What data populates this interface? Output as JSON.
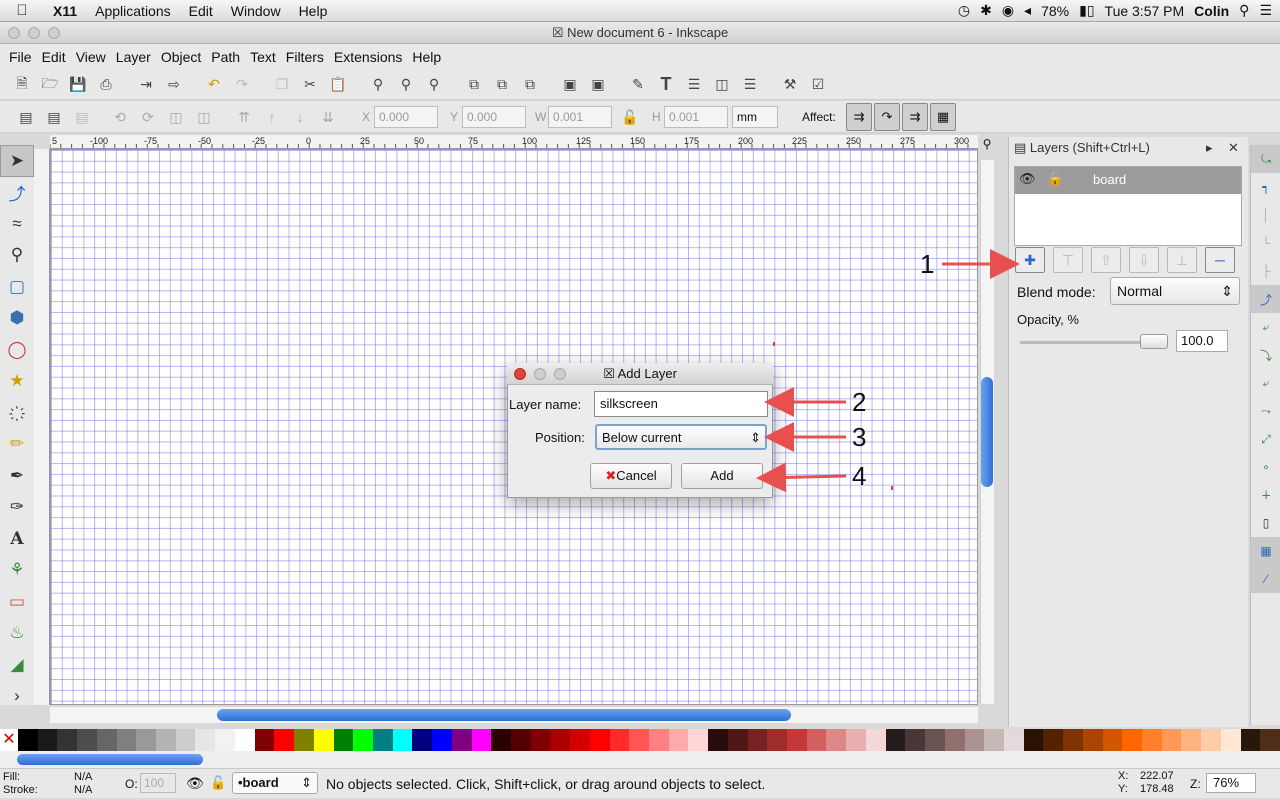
{
  "macbar": {
    "app": "X11",
    "menus": [
      "Applications",
      "Edit",
      "Window",
      "Help"
    ],
    "battery": "78%",
    "clock": "Tue 3:57 PM",
    "user": "Colin"
  },
  "window": {
    "title": "New document 6 - Inkscape"
  },
  "appmenu": [
    "File",
    "Edit",
    "View",
    "Layer",
    "Object",
    "Path",
    "Text",
    "Filters",
    "Extensions",
    "Help"
  ],
  "ctrl": {
    "x_label": "X",
    "x": "0.000",
    "y_label": "Y",
    "y": "0.000",
    "w_label": "W",
    "w": "0.001",
    "h_label": "H",
    "h": "0.001",
    "unit": "mm",
    "affect": "Affect:"
  },
  "ruler": {
    "h_ticks": [
      "5",
      "-100",
      "-75",
      "-50",
      "-25",
      "0",
      "25",
      "50",
      "75",
      "100",
      "125",
      "150",
      "175",
      "200",
      "225",
      "250",
      "275",
      "300"
    ]
  },
  "layers": {
    "title": "Layers (Shift+Ctrl+L)",
    "layer_name": "board",
    "blend_label": "Blend mode:",
    "blend_value": "Normal",
    "opacity_label": "Opacity, %",
    "opacity_value": "100.0"
  },
  "dialog": {
    "title": "Add Layer",
    "name_label": "Layer name:",
    "name_value": "silkscreen",
    "position_label": "Position:",
    "position_value": "Below current",
    "cancel": "Cancel",
    "add": "Add"
  },
  "annotations": [
    "1",
    "2",
    "3",
    "4"
  ],
  "status": {
    "fill_label": "Fill:",
    "fill": "N/A",
    "stroke_label": "Stroke:",
    "stroke": "N/A",
    "o_label": "O:",
    "o_value": "100",
    "layer": "•board",
    "message": "No objects selected. Click, Shift+click, or drag around objects to select.",
    "x_label": "X:",
    "x": "222.07",
    "y_label": "Y:",
    "y": "178.48",
    "z_label": "Z:",
    "zoom": "76%"
  },
  "palette": [
    "#000000",
    "#1a1a1a",
    "#333333",
    "#4d4d4d",
    "#666666",
    "#808080",
    "#999999",
    "#b3b3b3",
    "#cccccc",
    "#e6e6e6",
    "#f2f2f2",
    "#ffffff",
    "#800000",
    "#ff0000",
    "#808000",
    "#ffff00",
    "#008000",
    "#00ff00",
    "#008080",
    "#00ffff",
    "#000080",
    "#0000ff",
    "#800080",
    "#ff00ff",
    "#2b0000",
    "#550000",
    "#800000",
    "#aa0000",
    "#d40000",
    "#ff0000",
    "#ff2a2a",
    "#ff5555",
    "#ff8080",
    "#ffaaaa",
    "#ffd5d5",
    "#280b0b",
    "#501616",
    "#782121",
    "#a02c2c",
    "#c83737",
    "#d35f5f",
    "#de8787",
    "#e9afaf",
    "#f4d7d7",
    "#241c1c",
    "#483737",
    "#6c5353",
    "#916f6f",
    "#ac9393",
    "#c8b7b7",
    "#e3dbdb",
    "#2b1100",
    "#552200",
    "#803300",
    "#aa4400",
    "#d45500",
    "#ff6600",
    "#ff7f2a",
    "#ff9955",
    "#ffb380",
    "#ffccaa",
    "#ffe6d5",
    "#28170b",
    "#502d16"
  ]
}
